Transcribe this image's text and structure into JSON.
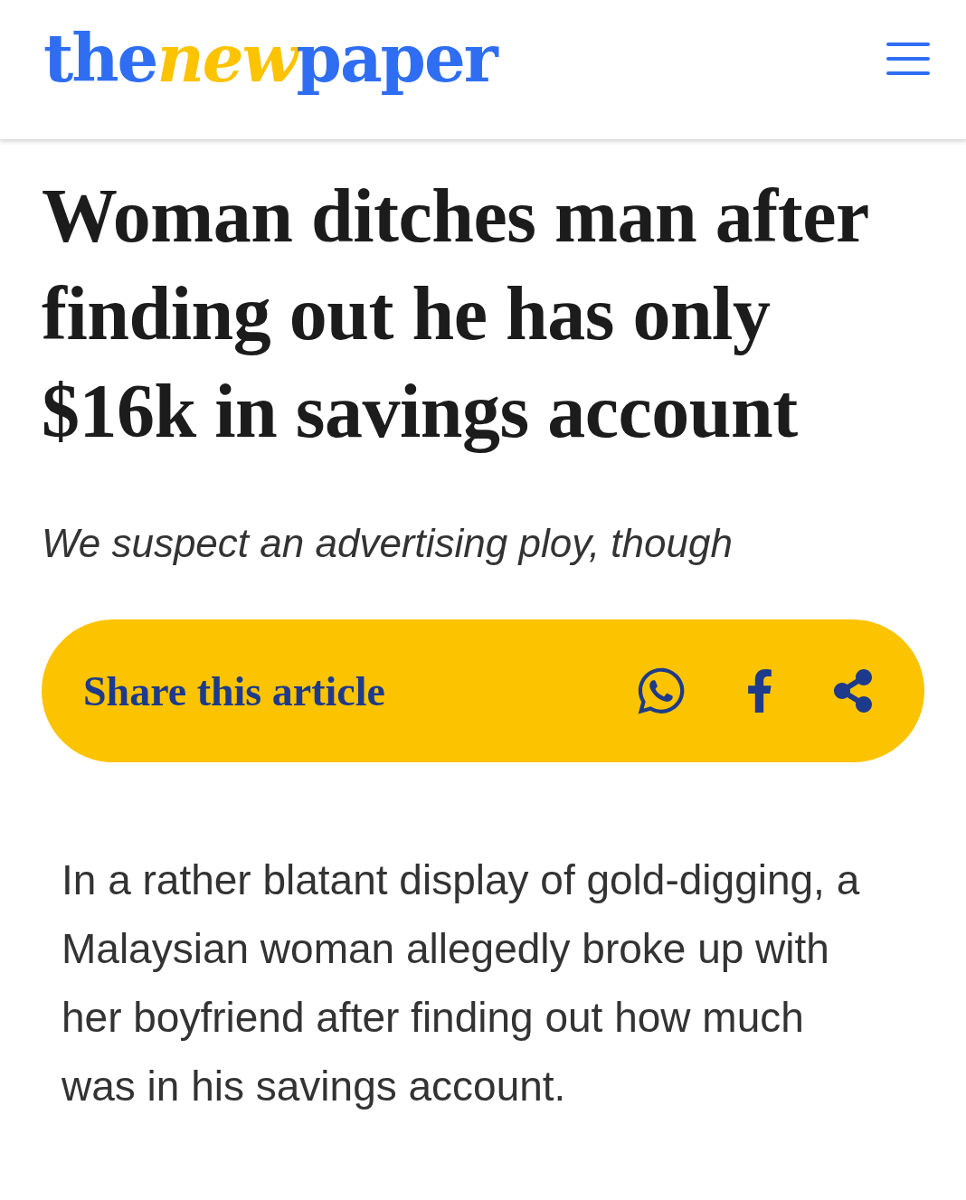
{
  "header": {
    "logo": [
      {
        "text": "the",
        "kind": "plain"
      },
      {
        "text": "new",
        "kind": "accent"
      },
      {
        "text": "paper",
        "kind": "plain"
      }
    ]
  },
  "article": {
    "headline": "Woman ditches man after finding out he has only $16k in savings account",
    "standfirst": "We suspect an advertising ploy, though",
    "share": {
      "label": "Share this article"
    },
    "body": "In a rather blatant display of gold-digging, a Malaysian woman allegedly broke up with her boyfriend after finding out how much was in his savings account."
  }
}
